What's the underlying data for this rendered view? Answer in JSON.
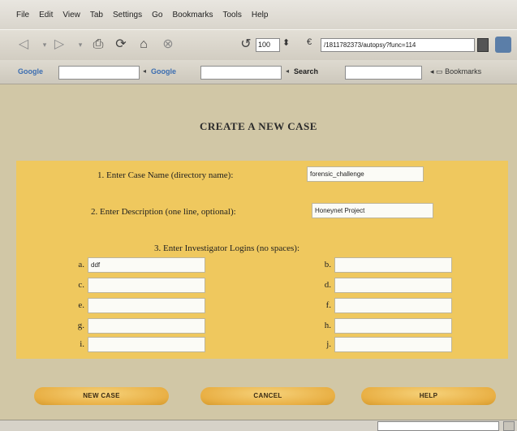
{
  "menu": [
    "File",
    "Edit",
    "View",
    "Tab",
    "Settings",
    "Go",
    "Bookmarks",
    "Tools",
    "Help"
  ],
  "toolbar": {
    "zoom": "100",
    "url": "/1811782373/autopsy?func=114",
    "icons": [
      "back-icon",
      "forward-icon",
      "print-icon",
      "reload-icon",
      "home-icon",
      "stop-icon"
    ]
  },
  "searchbar": {
    "engine1_label": "Google",
    "engine2_label": "Google",
    "engine3_label": "Search",
    "bookmarks_label": "Bookmarks"
  },
  "page": {
    "title": "CREATE A NEW CASE",
    "step1_label": "1. Enter Case Name (directory name):",
    "case_name_value": "forensic_challenge",
    "step2_label": "2. Enter Description (one line, optional):",
    "description_value": "Honeynet Project",
    "step3_label": "3. Enter Investigator Logins (no spaces):",
    "investigators": [
      {
        "letter": "a.",
        "value": "ddf"
      },
      {
        "letter": "b.",
        "value": ""
      },
      {
        "letter": "c.",
        "value": ""
      },
      {
        "letter": "d.",
        "value": ""
      },
      {
        "letter": "e.",
        "value": ""
      },
      {
        "letter": "f.",
        "value": ""
      },
      {
        "letter": "g.",
        "value": ""
      },
      {
        "letter": "h.",
        "value": ""
      },
      {
        "letter": "i.",
        "value": ""
      },
      {
        "letter": "j.",
        "value": ""
      }
    ],
    "buttons": {
      "new_case": "NEW CASE",
      "cancel": "CANCEL",
      "help": "HELP"
    }
  },
  "colors": {
    "page_bg": "#d1c7a6",
    "form_panel": "#efc85e",
    "button": "#e9b045"
  }
}
